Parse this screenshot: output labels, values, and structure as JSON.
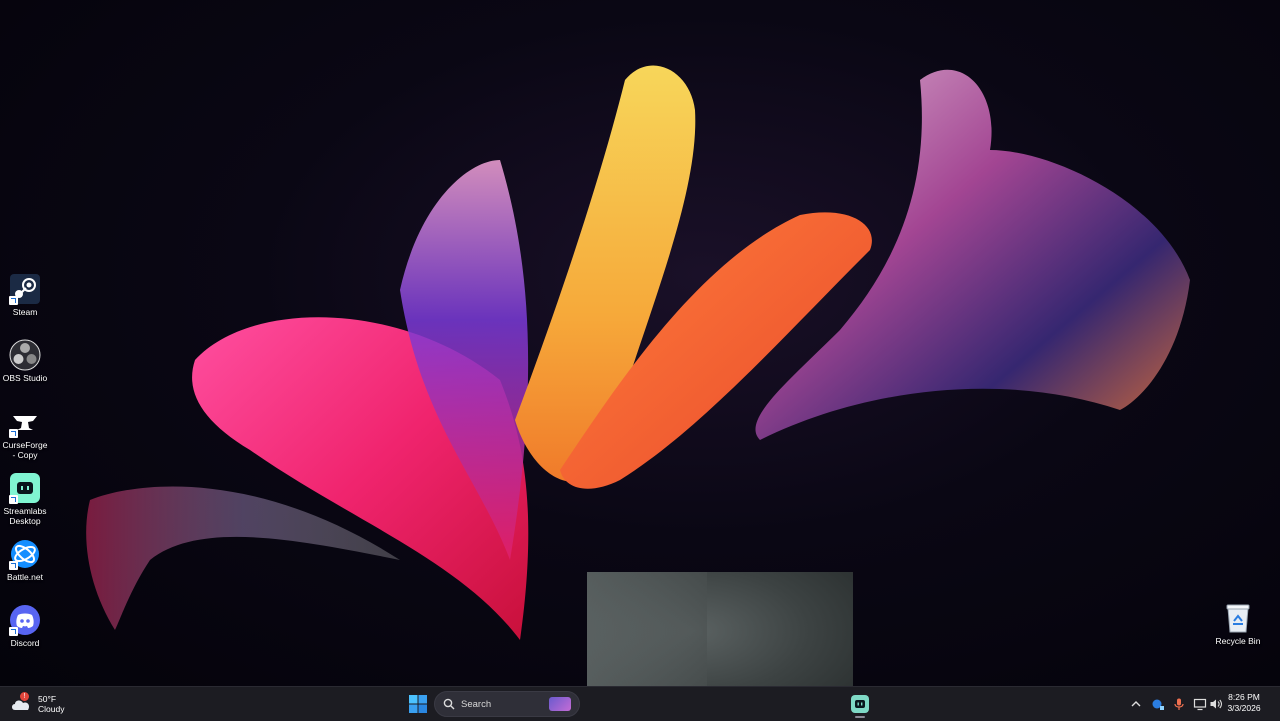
{
  "desktop": {
    "icons": [
      {
        "label": "Steam",
        "icon": "steam-icon"
      },
      {
        "label": "OBS Studio",
        "icon": "obs-icon"
      },
      {
        "label": "CurseForge - Copy",
        "icon": "curseforge-icon"
      },
      {
        "label": "Streamlabs Desktop",
        "icon": "streamlabs-icon"
      },
      {
        "label": "Battle.net",
        "icon": "battlenet-icon"
      },
      {
        "label": "Discord",
        "icon": "discord-icon"
      }
    ],
    "recycle_bin": {
      "label": "Recycle Bin",
      "icon": "recycle-bin-icon"
    }
  },
  "taskbar": {
    "weather": {
      "temp": "50°F",
      "condition": "Cloudy",
      "badge": "!",
      "icon": "cloudy-icon"
    },
    "search": {
      "placeholder": "Search",
      "icon": "search-icon"
    },
    "start_icon": "windows-start-icon",
    "pinned": [
      {
        "name": "Streamlabs Desktop",
        "icon": "streamlabs-icon"
      }
    ],
    "tray_icons": [
      "chevron-up-icon",
      "network-app-icon",
      "microphone-icon",
      "display-icon",
      "volume-icon"
    ],
    "clock": {
      "time": "8:26 PM",
      "date": "3/3/2026"
    }
  },
  "colors": {
    "taskbar_bg": "#1c1c22",
    "accent": "#1b6fd6",
    "streamlabs": "#7fd9c6",
    "discord": "#5865f2"
  }
}
